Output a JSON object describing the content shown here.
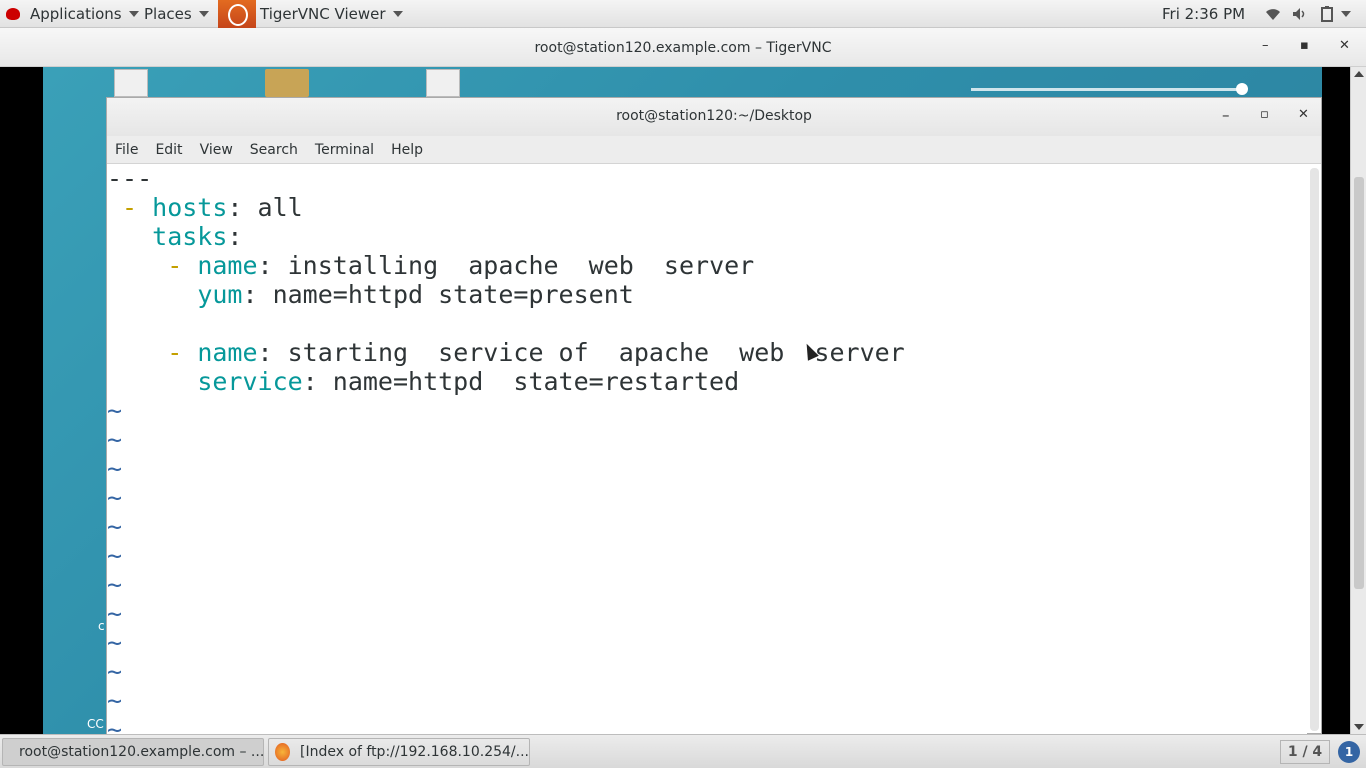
{
  "top_panel": {
    "applications": "Applications",
    "places": "Places",
    "active_app": "TigerVNC Viewer",
    "clock": "Fri  2:36 PM"
  },
  "vnc_window": {
    "title": "root@station120.example.com – TigerVNC",
    "minimize": "–",
    "maximize": "▪",
    "close": "✕"
  },
  "terminal": {
    "title": "root@station120:~/Desktop",
    "menu": [
      "File",
      "Edit",
      "View",
      "Search",
      "Terminal",
      "Help"
    ],
    "lines": [
      {
        "parts": [
          {
            "t": "---",
            "c": ""
          }
        ]
      },
      {
        "parts": [
          {
            "t": " - ",
            "c": "d"
          },
          {
            "t": "hosts",
            "c": "k"
          },
          {
            "t": ": all",
            "c": ""
          }
        ]
      },
      {
        "parts": [
          {
            "t": "   ",
            "c": ""
          },
          {
            "t": "tasks",
            "c": "k"
          },
          {
            "t": ":",
            "c": ""
          }
        ]
      },
      {
        "parts": [
          {
            "t": "    - ",
            "c": "d"
          },
          {
            "t": "name",
            "c": "k"
          },
          {
            "t": ": installing  apache  web  server",
            "c": ""
          }
        ]
      },
      {
        "parts": [
          {
            "t": "      ",
            "c": ""
          },
          {
            "t": "yum",
            "c": "k"
          },
          {
            "t": ": name=httpd state=present",
            "c": ""
          }
        ]
      },
      {
        "parts": [
          {
            "t": "",
            "c": ""
          }
        ]
      },
      {
        "parts": [
          {
            "t": "    - ",
            "c": "d"
          },
          {
            "t": "name",
            "c": "k"
          },
          {
            "t": ": starting  service of  apache  web  server",
            "c": ""
          }
        ]
      },
      {
        "parts": [
          {
            "t": "      ",
            "c": ""
          },
          {
            "t": "service",
            "c": "k"
          },
          {
            "t": ": name=httpd  state=restarted",
            "c": ""
          }
        ]
      },
      {
        "parts": [
          {
            "t": "~",
            "c": "tl"
          }
        ]
      },
      {
        "parts": [
          {
            "t": "~",
            "c": "tl"
          }
        ]
      },
      {
        "parts": [
          {
            "t": "~",
            "c": "tl"
          }
        ]
      },
      {
        "parts": [
          {
            "t": "~",
            "c": "tl"
          }
        ]
      },
      {
        "parts": [
          {
            "t": "~",
            "c": "tl"
          }
        ]
      },
      {
        "parts": [
          {
            "t": "~",
            "c": "tl"
          }
        ]
      },
      {
        "parts": [
          {
            "t": "~",
            "c": "tl"
          }
        ]
      },
      {
        "parts": [
          {
            "t": "~",
            "c": "tl"
          }
        ]
      },
      {
        "parts": [
          {
            "t": "~",
            "c": "tl"
          }
        ]
      },
      {
        "parts": [
          {
            "t": "~",
            "c": "tl"
          }
        ]
      },
      {
        "parts": [
          {
            "t": "~",
            "c": "tl"
          }
        ]
      },
      {
        "parts": [
          {
            "t": "~",
            "c": "tl"
          }
        ]
      }
    ]
  },
  "desktop": {
    "edge_letters": [
      "c",
      "CC"
    ]
  },
  "taskbar": {
    "tasks": [
      "root@station120.example.com – ...",
      "[Index of ftp://192.168.10.254/..."
    ],
    "pager": "1 / 4",
    "notifications": "1"
  }
}
